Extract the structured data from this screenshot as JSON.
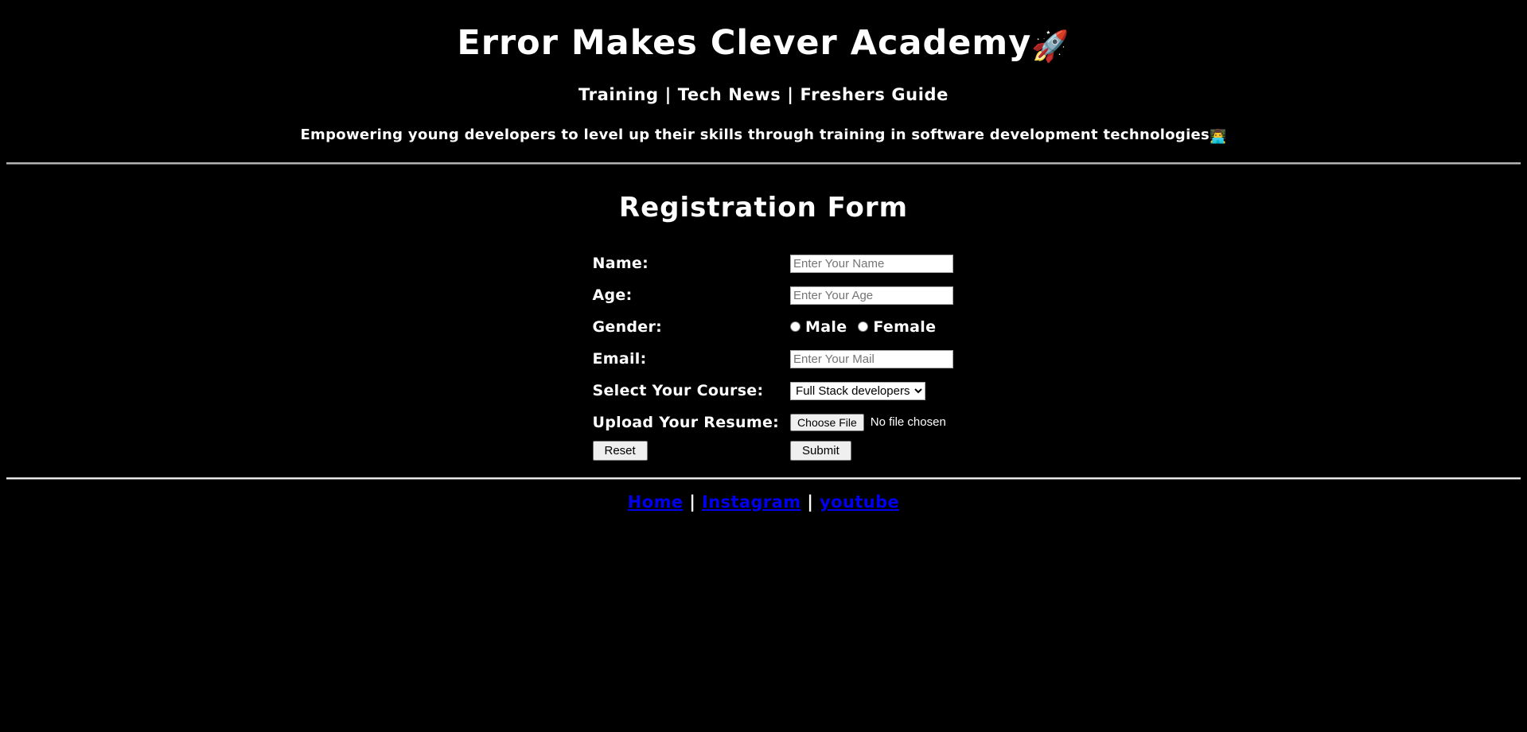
{
  "header": {
    "title": "Error Makes Clever Academy",
    "title_icon": "rocket-icon",
    "title_icon_glyph": "🚀",
    "nav_line": "Training | Tech News | Freshers Guide",
    "nav_items": [
      "Training",
      "Tech News",
      "Freshers Guide"
    ],
    "tagline": "Empowering young developers to level up their skills through training in software development technologies",
    "tagline_icon": "person-at-computer-icon",
    "tagline_icon_glyph": "👨‍💻"
  },
  "form": {
    "heading": "Registration Form",
    "fields": {
      "name": {
        "label": "Name:",
        "placeholder": "Enter Your Name",
        "value": ""
      },
      "age": {
        "label": "Age:",
        "placeholder": "Enter Your Age",
        "value": ""
      },
      "gender": {
        "label": "Gender:",
        "options": [
          "Male",
          "Female"
        ],
        "male_label": "Male",
        "female_label": "Female",
        "selected": ""
      },
      "email": {
        "label": "Email:",
        "placeholder": "Enter Your Mail",
        "value": ""
      },
      "course": {
        "label": "Select Your Course:",
        "selected": "Full Stack developers",
        "options": [
          "Full Stack developers"
        ]
      },
      "resume": {
        "label": "Upload Your Resume:",
        "button_label": "Choose File",
        "status": "No file chosen"
      }
    },
    "buttons": {
      "reset": "Reset",
      "submit": "Submit"
    }
  },
  "footer": {
    "links": [
      {
        "label": "Home"
      },
      {
        "label": "Instagram"
      },
      {
        "label": "youtube"
      }
    ],
    "separator": "|"
  },
  "colors": {
    "background": "#000000",
    "text": "#ffffff",
    "link": "#0000ee",
    "rule": "#b4b4b4",
    "field_background": "#ffffff",
    "placeholder": "#757575",
    "button_background": "#efefef"
  }
}
